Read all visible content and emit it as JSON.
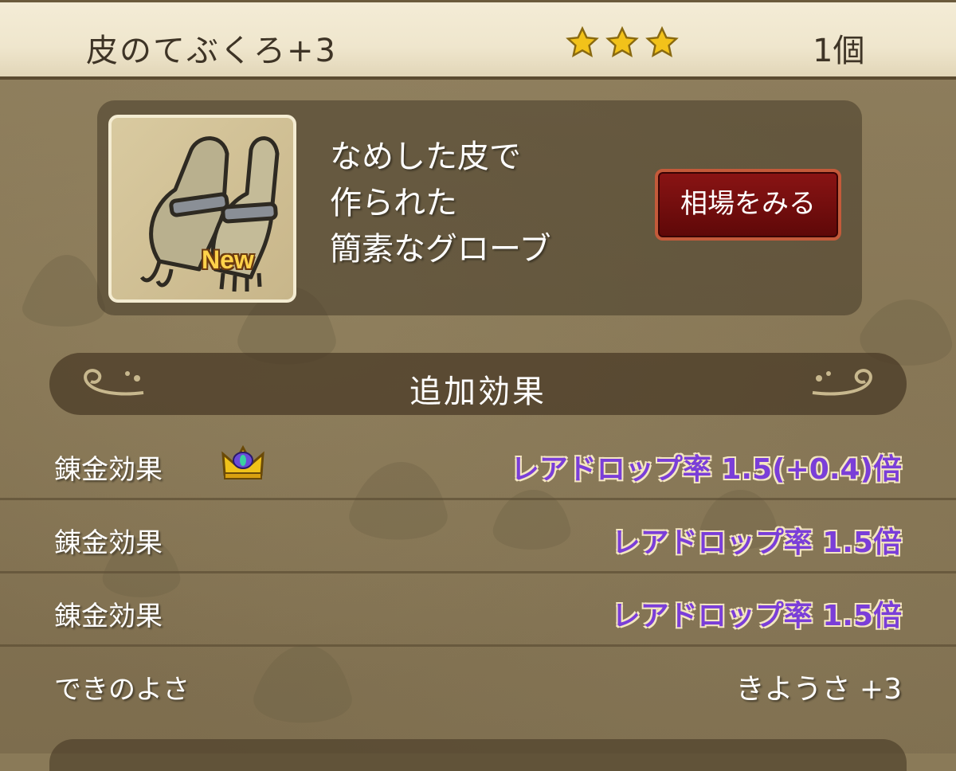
{
  "header": {
    "item_name": "皮のてぶくろ+3",
    "star_count": 3,
    "quantity": "1個"
  },
  "item": {
    "icon": "leather-gloves-icon",
    "badge": "New",
    "description_lines": [
      "なめした皮で",
      "作られた",
      "簡素なグローブ"
    ],
    "market_button": "相場をみる"
  },
  "effects": {
    "title": "追加効果",
    "rows": [
      {
        "label": "錬金効果",
        "value": "レアドロップ率  1.5(+0.4)倍",
        "crown": true
      },
      {
        "label": "錬金効果",
        "value": "レアドロップ率  1.5倍",
        "crown": false
      },
      {
        "label": "錬金効果",
        "value": "レアドロップ率  1.5倍",
        "crown": false
      },
      {
        "label": "できのよさ",
        "value": "きようさ  +3",
        "crown": false
      }
    ]
  },
  "colors": {
    "effect_text": "#7a3ed8",
    "button_red": "#7a1010",
    "star": "#f2c21a"
  }
}
